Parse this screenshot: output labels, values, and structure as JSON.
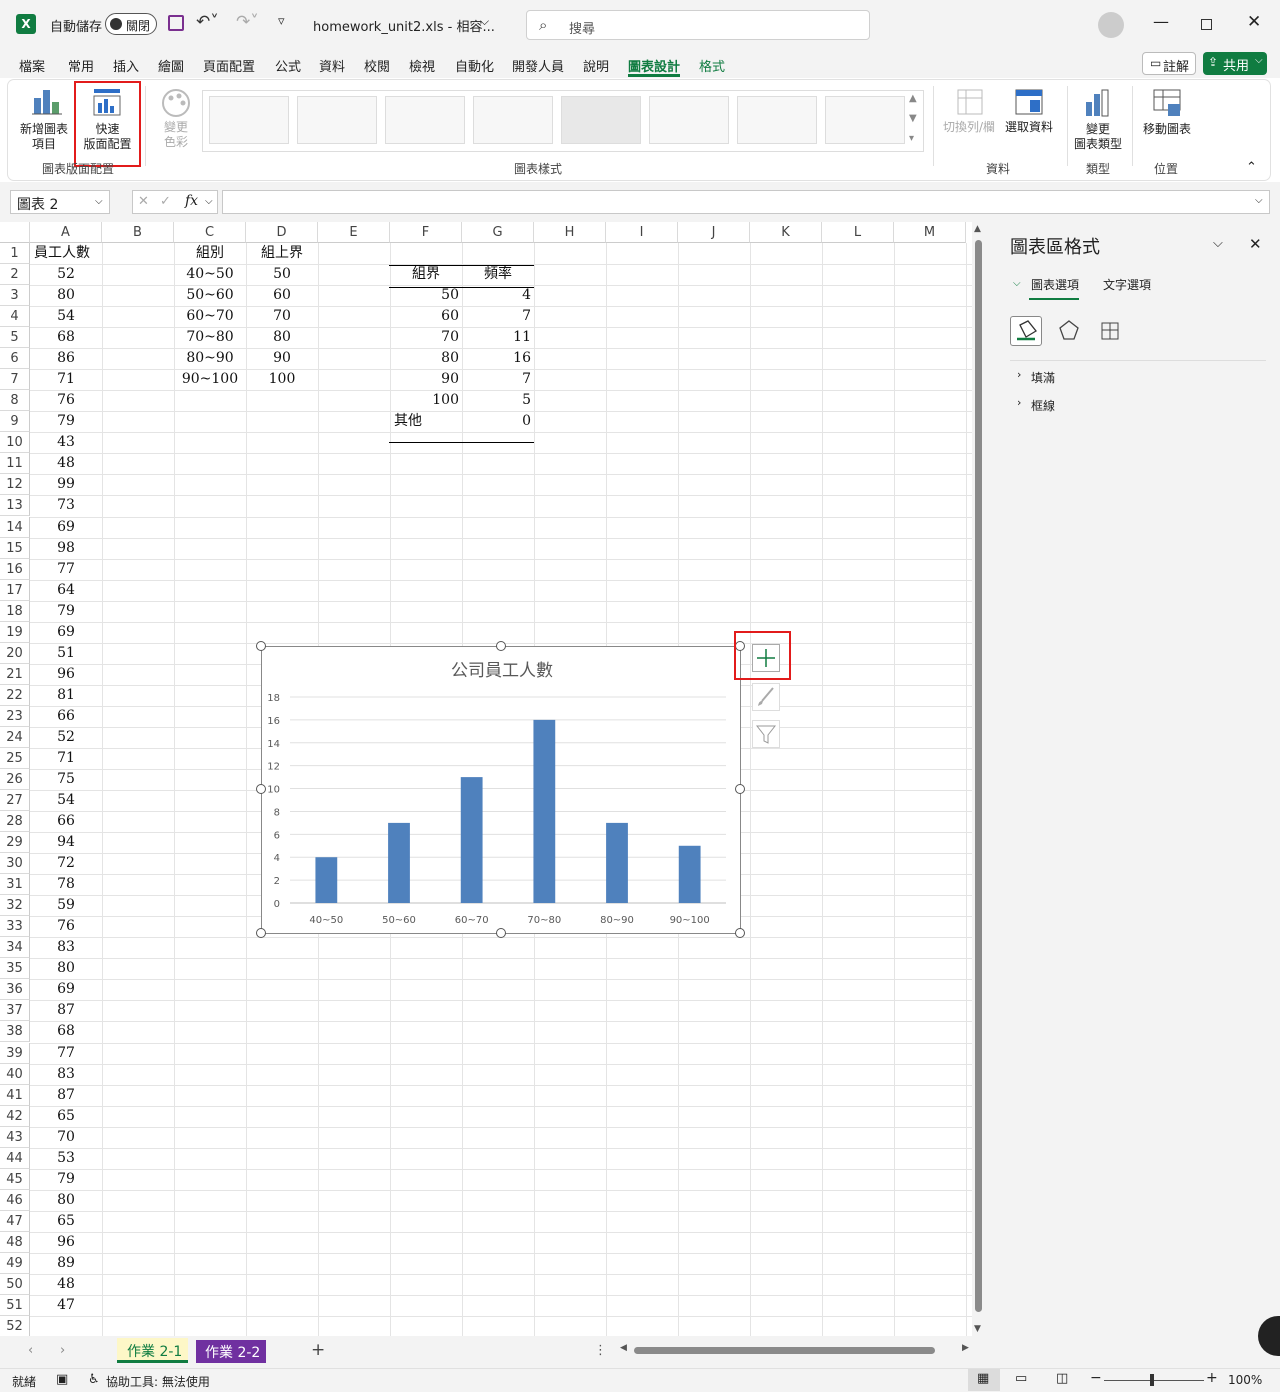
{
  "titlebar": {
    "autosave_label": "自動儲存",
    "autosave_state": "關閉",
    "filename": "homework_unit2.xls  -  相容...",
    "search_placeholder": "搜尋"
  },
  "menu": [
    "檔案",
    "常用",
    "插入",
    "繪圖",
    "頁面配置",
    "公式",
    "資料",
    "校閱",
    "檢視",
    "自動化",
    "開發人員",
    "說明",
    "圖表設計",
    "格式"
  ],
  "menu_active_index": 12,
  "menu_right": {
    "comment": "註解",
    "share": "共用"
  },
  "ribbon": {
    "add_element": "新增圖表\n項目",
    "quick_layout": "快速\n版面配置",
    "change_colors": "變更\n色彩",
    "group_layout": "圖表版面配置",
    "group_styles": "圖表樣式",
    "switch_row_col": "切換列/欄",
    "select_data": "選取資料",
    "group_data": "資料",
    "change_type": "變更\n圖表類型",
    "group_type": "類型",
    "move_chart": "移動圖表",
    "group_location": "位置"
  },
  "formula": {
    "name_box": "圖表 2",
    "fx": "fx",
    "value": ""
  },
  "columns": [
    "A",
    "B",
    "C",
    "D",
    "E",
    "F",
    "G",
    "H",
    "I",
    "J",
    "K",
    "L",
    "M"
  ],
  "colA": [
    "員工人數",
    "52",
    "80",
    "54",
    "68",
    "86",
    "71",
    "76",
    "79",
    "43",
    "48",
    "99",
    "73",
    "69",
    "98",
    "77",
    "64",
    "79",
    "69",
    "51",
    "96",
    "81",
    "66",
    "52",
    "71",
    "75",
    "54",
    "66",
    "94",
    "72",
    "78",
    "59",
    "76",
    "83",
    "80",
    "69",
    "87",
    "68",
    "77",
    "83",
    "87",
    "65",
    "70",
    "53",
    "79",
    "80",
    "65",
    "96",
    "89",
    "48",
    "47"
  ],
  "colC": [
    "組別",
    "40~50",
    "50~60",
    "60~70",
    "70~80",
    "80~90",
    "90~100"
  ],
  "colD": [
    "組上界",
    "50",
    "60",
    "70",
    "80",
    "90",
    "100"
  ],
  "freq_table": {
    "headers": [
      "組界",
      "頻率"
    ],
    "rows": [
      [
        "50",
        "4"
      ],
      [
        "60",
        "7"
      ],
      [
        "70",
        "11"
      ],
      [
        "80",
        "16"
      ],
      [
        "90",
        "7"
      ],
      [
        "100",
        "5"
      ],
      [
        "其他",
        "0"
      ]
    ]
  },
  "chart_data": {
    "type": "bar",
    "title": "公司員工人數",
    "categories": [
      "40~50",
      "50~60",
      "60~70",
      "70~80",
      "80~90",
      "90~100"
    ],
    "values": [
      4,
      7,
      11,
      16,
      7,
      5
    ],
    "ylim": [
      0,
      18
    ],
    "yticks": [
      "0",
      "2",
      "4",
      "6",
      "8",
      "10",
      "12",
      "14",
      "16",
      "18"
    ],
    "grid": true,
    "bar_color": "#4f81bd"
  },
  "pane": {
    "title": "圖表區格式",
    "tab1": "圖表選項",
    "tab2": "文字選項",
    "sec1": "填滿",
    "sec2": "框線"
  },
  "sheet_tabs": [
    "作業 2-1",
    "作業 2-2"
  ],
  "status": {
    "ready": "就緒",
    "accessibility": "協助工具: 無法使用",
    "zoom": "100%"
  }
}
